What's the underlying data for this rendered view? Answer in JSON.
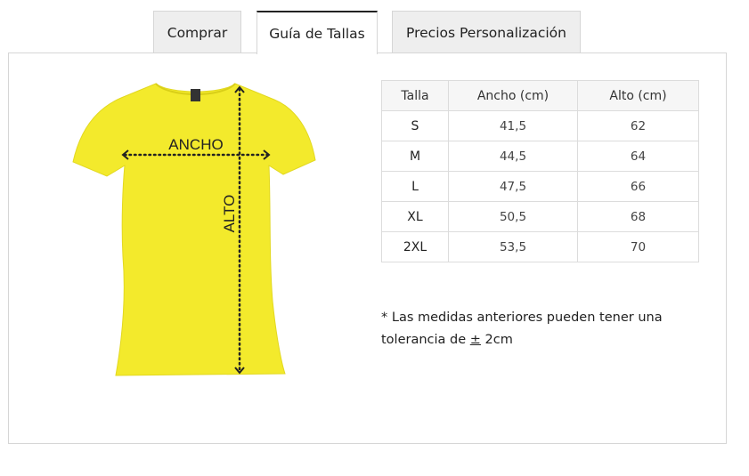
{
  "tabs": [
    {
      "label": "Comprar",
      "active": false
    },
    {
      "label": "Guía de Tallas",
      "active": true
    },
    {
      "label": "Precios Personalización",
      "active": false
    }
  ],
  "diagram": {
    "width_label": "ANCHO",
    "height_label": "ALTO",
    "shirt_color": "#f3ea2c"
  },
  "size_table": {
    "headers": [
      "Talla",
      "Ancho (cm)",
      "Alto (cm)"
    ],
    "rows": [
      [
        "S",
        "41,5",
        "62"
      ],
      [
        "M",
        "44,5",
        "64"
      ],
      [
        "L",
        "47,5",
        "66"
      ],
      [
        "XL",
        "50,5",
        "68"
      ],
      [
        "2XL",
        "53,5",
        "70"
      ]
    ]
  },
  "note": {
    "prefix": "* Las medidas anteriores pueden tener una tolerancia de ",
    "symbol": "±",
    "suffix": " 2cm"
  }
}
